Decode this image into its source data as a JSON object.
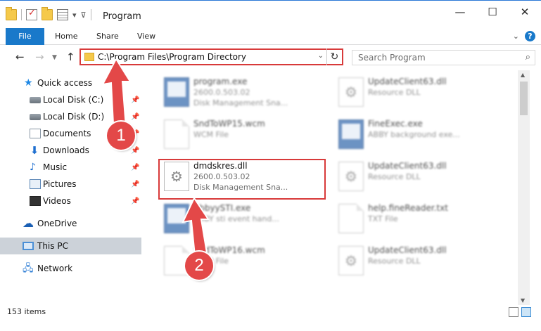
{
  "window": {
    "title": "Program",
    "controls": [
      "—",
      "☐",
      "✕"
    ]
  },
  "ribbon": {
    "tabs": [
      "File",
      "Home",
      "Share",
      "View"
    ]
  },
  "address_bar": {
    "path": "C:\\Program Files\\Program Directory"
  },
  "search": {
    "placeholder": "Search Program"
  },
  "sidebar": {
    "items": [
      {
        "label": "Quick access",
        "icon": "star-icon"
      },
      {
        "label": "Local Disk (C:)",
        "icon": "disk-icon",
        "pinned": true
      },
      {
        "label": "Local Disk (D:)",
        "icon": "disk-icon",
        "pinned": true
      },
      {
        "label": "Documents",
        "icon": "documents-icon",
        "pinned": true
      },
      {
        "label": "Downloads",
        "icon": "downloads-icon",
        "pinned": true
      },
      {
        "label": "Music",
        "icon": "music-icon",
        "pinned": true
      },
      {
        "label": "Pictures",
        "icon": "pictures-icon",
        "pinned": true
      },
      {
        "label": "Videos",
        "icon": "videos-icon",
        "pinned": true
      },
      {
        "label": "OneDrive",
        "icon": "onedrive-icon"
      },
      {
        "label": "This PC",
        "icon": "pc-icon",
        "selected": true
      },
      {
        "label": "Network",
        "icon": "network-icon"
      }
    ]
  },
  "files": [
    {
      "name": "program.exe",
      "line2": "2600.0.503.02",
      "line3": "Disk Management Sna...",
      "type": "exe"
    },
    {
      "name": "UpdateClient63.dll",
      "line2": "Resource DLL",
      "line3": "",
      "type": "dll"
    },
    {
      "name": "SndToWP15.wcm",
      "line2": "WCM File",
      "line3": "",
      "type": "doc"
    },
    {
      "name": "FineExec.exe",
      "line2": "ABBY background exe...",
      "line3": "",
      "type": "exe"
    },
    {
      "name": "dmdskres.dll",
      "line2": "2600.0.503.02",
      "line3": "Disk Management Sna...",
      "type": "dll",
      "highlighted": true
    },
    {
      "name": "UpdateClient63.dll",
      "line2": "Resource DLL",
      "line3": "",
      "type": "dll"
    },
    {
      "name": "AbbyySTI.exe",
      "line2": "ABBY sti event hand...",
      "line3": "",
      "type": "exe"
    },
    {
      "name": "help.fineReader.txt",
      "line2": "TXT File",
      "line3": "",
      "type": "doc"
    },
    {
      "name": "SndToWP16.wcm",
      "line2": "WCM File",
      "line3": "",
      "type": "doc"
    },
    {
      "name": "UpdateClient63.dll",
      "line2": "Resource DLL",
      "line3": "",
      "type": "dll"
    }
  ],
  "status": {
    "item_count": "153 items"
  },
  "annotations": {
    "step1": "1",
    "step2": "2",
    "color": "#e34848"
  }
}
